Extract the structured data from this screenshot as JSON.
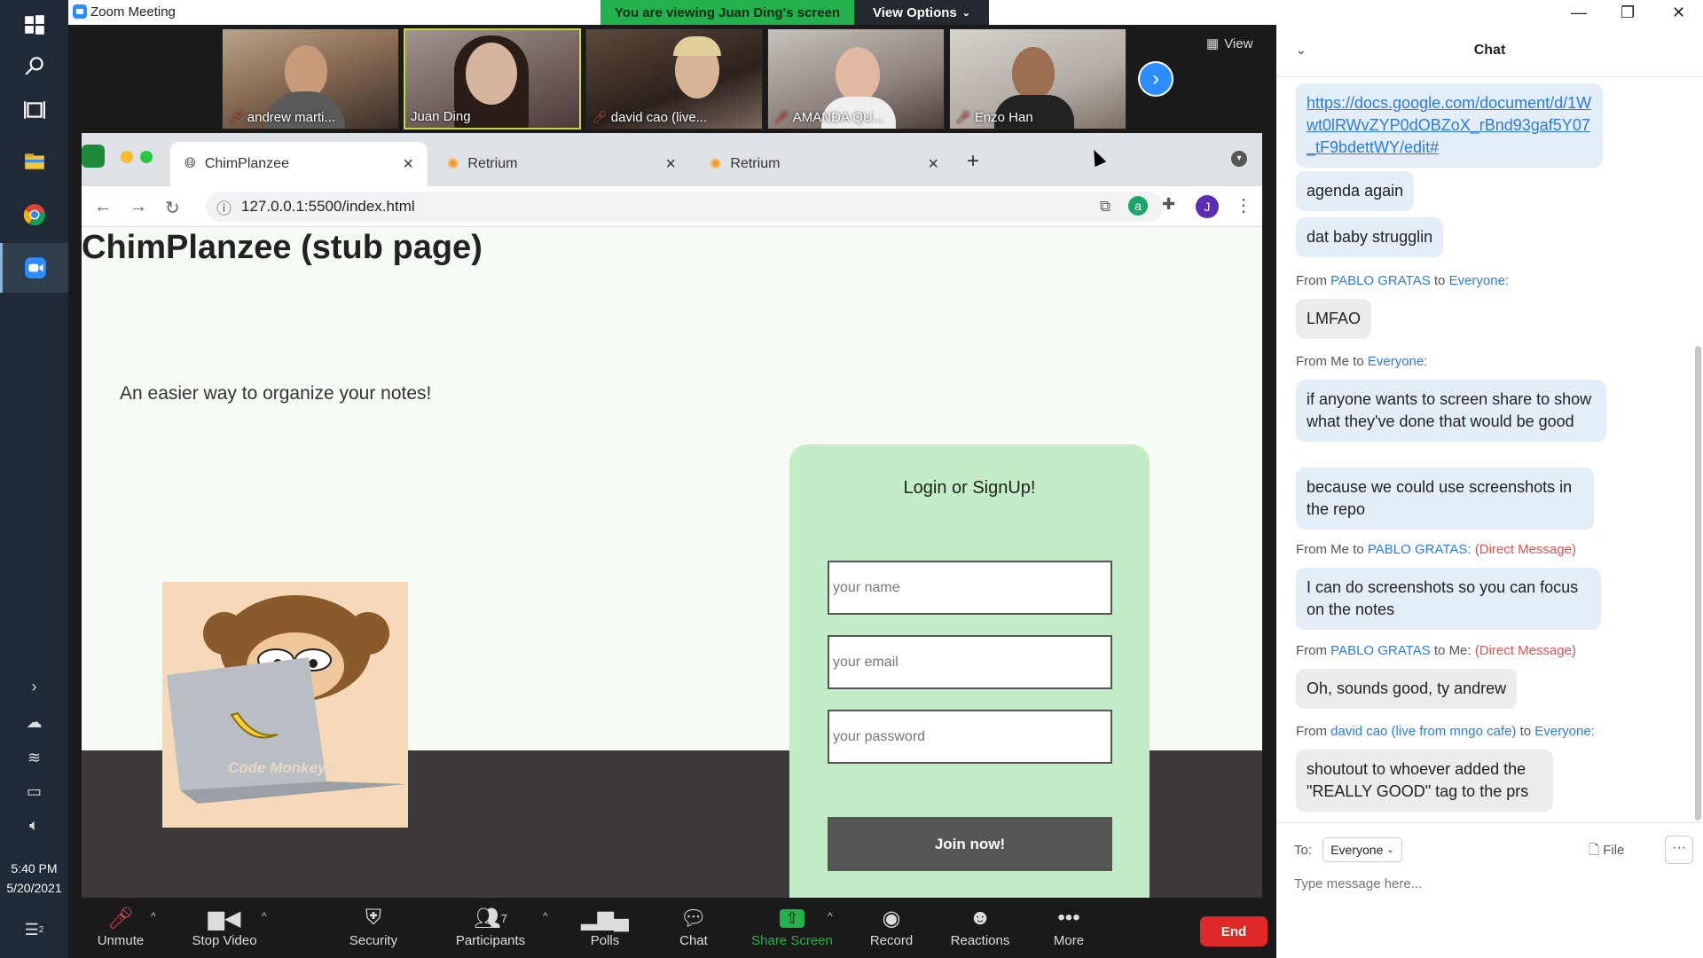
{
  "taskbar": {
    "time": "5:40 PM",
    "date": "5/20/2021",
    "notif_count": "2"
  },
  "zoom": {
    "title": "Zoom Meeting",
    "banner": "You are viewing Juan Ding's screen",
    "view_options": "View Options",
    "view_label": "View",
    "participants": [
      {
        "name": "andrew marti...",
        "muted": true
      },
      {
        "name": "Juan Ding",
        "muted": false
      },
      {
        "name": "david cao (live...",
        "muted": true
      },
      {
        "name": "AMANDA QU...",
        "muted": true
      },
      {
        "name": "Enzo Han",
        "muted": true
      }
    ],
    "toolbar": {
      "unmute": "Unmute",
      "stop_video": "Stop Video",
      "security": "Security",
      "participants": "Participants",
      "participants_count": "7",
      "polls": "Polls",
      "chat": "Chat",
      "share": "Share Screen",
      "record": "Record",
      "reactions": "Reactions",
      "more": "More",
      "end": "End"
    }
  },
  "browser": {
    "tabs": [
      {
        "title": "ChimPlanzee",
        "active": true
      },
      {
        "title": "Retrium",
        "active": false
      },
      {
        "title": "Retrium",
        "active": false
      }
    ],
    "url": "127.0.0.1:5500/index.html",
    "profile_initial": "J"
  },
  "page": {
    "title": "ChimPlanzee (stub page)",
    "tagline": "An easier way to organize your notes!",
    "logo_text": "Code Monkeys",
    "login_title": "Login or SignUp!",
    "name_placeholder": "your name",
    "email_placeholder": "your email",
    "password_placeholder": "your password",
    "join_button": "Join now!"
  },
  "chat": {
    "header": "Chat",
    "messages": {
      "link": "https://docs.google.com/document/d/1Wwt0lRWvZYP0dOBZoX_rBnd93gaf5Y07_tF9bdettWY/edit#",
      "m1": "agenda again",
      "m2": "dat baby strugglin",
      "from3_sender": "PABLO GRATAS",
      "from3_recipient": "Everyone:",
      "m3": "LMFAO",
      "from4_sender": "Me",
      "from4_recipient": "Everyone:",
      "m4": "if anyone wants to screen share to show what they've done that would be good",
      "m5": "because we could use screenshots in the repo",
      "from6_sender": "Me",
      "from6_recipient": "PABLO GRATAS:",
      "from6_dm": "(Direct Message)",
      "m6": "I can do screenshots so you can focus on the notes",
      "from7_sender": "PABLO GRATAS",
      "from7_recipient": "Me:",
      "from7_dm": "(Direct Message)",
      "m7": "Oh, sounds good, ty andrew",
      "from8_sender": "david cao (live from mngo cafe)",
      "from8_recipient": "Everyone:",
      "m8": "shoutout to whoever added the \"REALLY GOOD\" tag to the prs"
    },
    "from_word": "From",
    "to_word": "to",
    "to_label": "To:",
    "to_value": "Everyone",
    "file_label": "File",
    "input_placeholder": "Type message here..."
  }
}
